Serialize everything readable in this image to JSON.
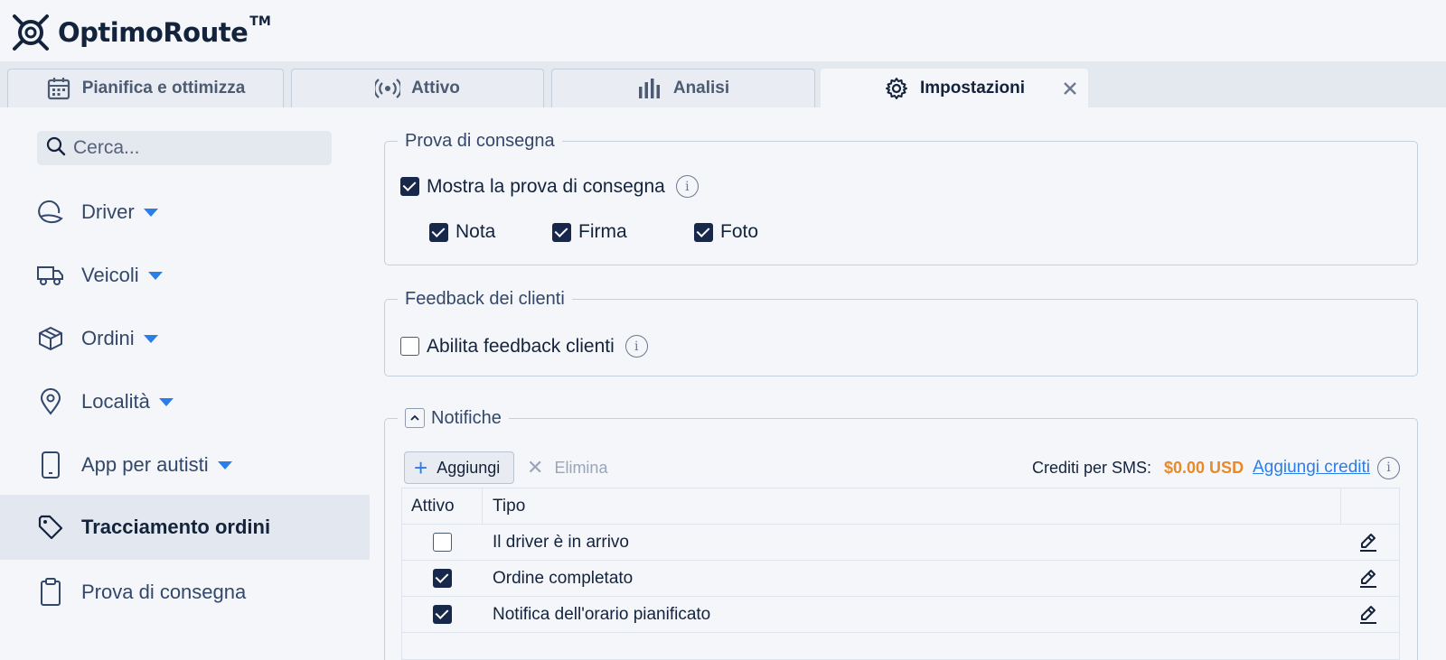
{
  "brand": {
    "name": "OptimoRoute",
    "tm": "TM"
  },
  "tabs": [
    {
      "label": "Pianifica e ottimizza",
      "icon": "calendar-icon"
    },
    {
      "label": "Attivo",
      "icon": "broadcast-icon"
    },
    {
      "label": "Analisi",
      "icon": "bar-chart-icon"
    },
    {
      "label": "Impostazioni",
      "icon": "gear-icon",
      "active": true
    }
  ],
  "sidebar": {
    "search_placeholder": "Cerca...",
    "items": [
      {
        "label": "Driver",
        "icon": "driver-icon",
        "has_caret": true
      },
      {
        "label": "Veicoli",
        "icon": "truck-icon",
        "has_caret": true
      },
      {
        "label": "Ordini",
        "icon": "package-icon",
        "has_caret": true
      },
      {
        "label": "Località",
        "icon": "location-pin-icon",
        "has_caret": true
      },
      {
        "label": "App per autisti",
        "icon": "phone-icon",
        "has_caret": true
      },
      {
        "label": "Tracciamento ordini",
        "icon": "tag-icon",
        "active": true
      },
      {
        "label": "Prova di consegna",
        "icon": "clipboard-icon"
      }
    ]
  },
  "proof": {
    "legend": "Prova di consegna",
    "show_label": "Mostra la prova di consegna",
    "show_checked": true,
    "options": [
      {
        "label": "Nota",
        "checked": true
      },
      {
        "label": "Firma",
        "checked": true
      },
      {
        "label": "Foto",
        "checked": true
      }
    ]
  },
  "feedback": {
    "legend": "Feedback dei clienti",
    "enable_label": "Abilita feedback clienti",
    "enable_checked": false
  },
  "notifications": {
    "legend": "Notifiche",
    "add_label": "Aggiungi",
    "delete_label": "Elimina",
    "credits_label": "Crediti per SMS:",
    "credits_amount": "$0.00 USD",
    "add_credits_label": "Aggiungi crediti",
    "columns": [
      "Attivo",
      "Tipo"
    ],
    "rows": [
      {
        "active": false,
        "type": "Il driver è in arrivo"
      },
      {
        "active": true,
        "type": "Ordine completato"
      },
      {
        "active": true,
        "type": "Notifica dell'orario pianificato"
      }
    ]
  },
  "colors": {
    "accent": "#2b7de9",
    "credits": "#e8892a",
    "navy": "#17284a"
  }
}
